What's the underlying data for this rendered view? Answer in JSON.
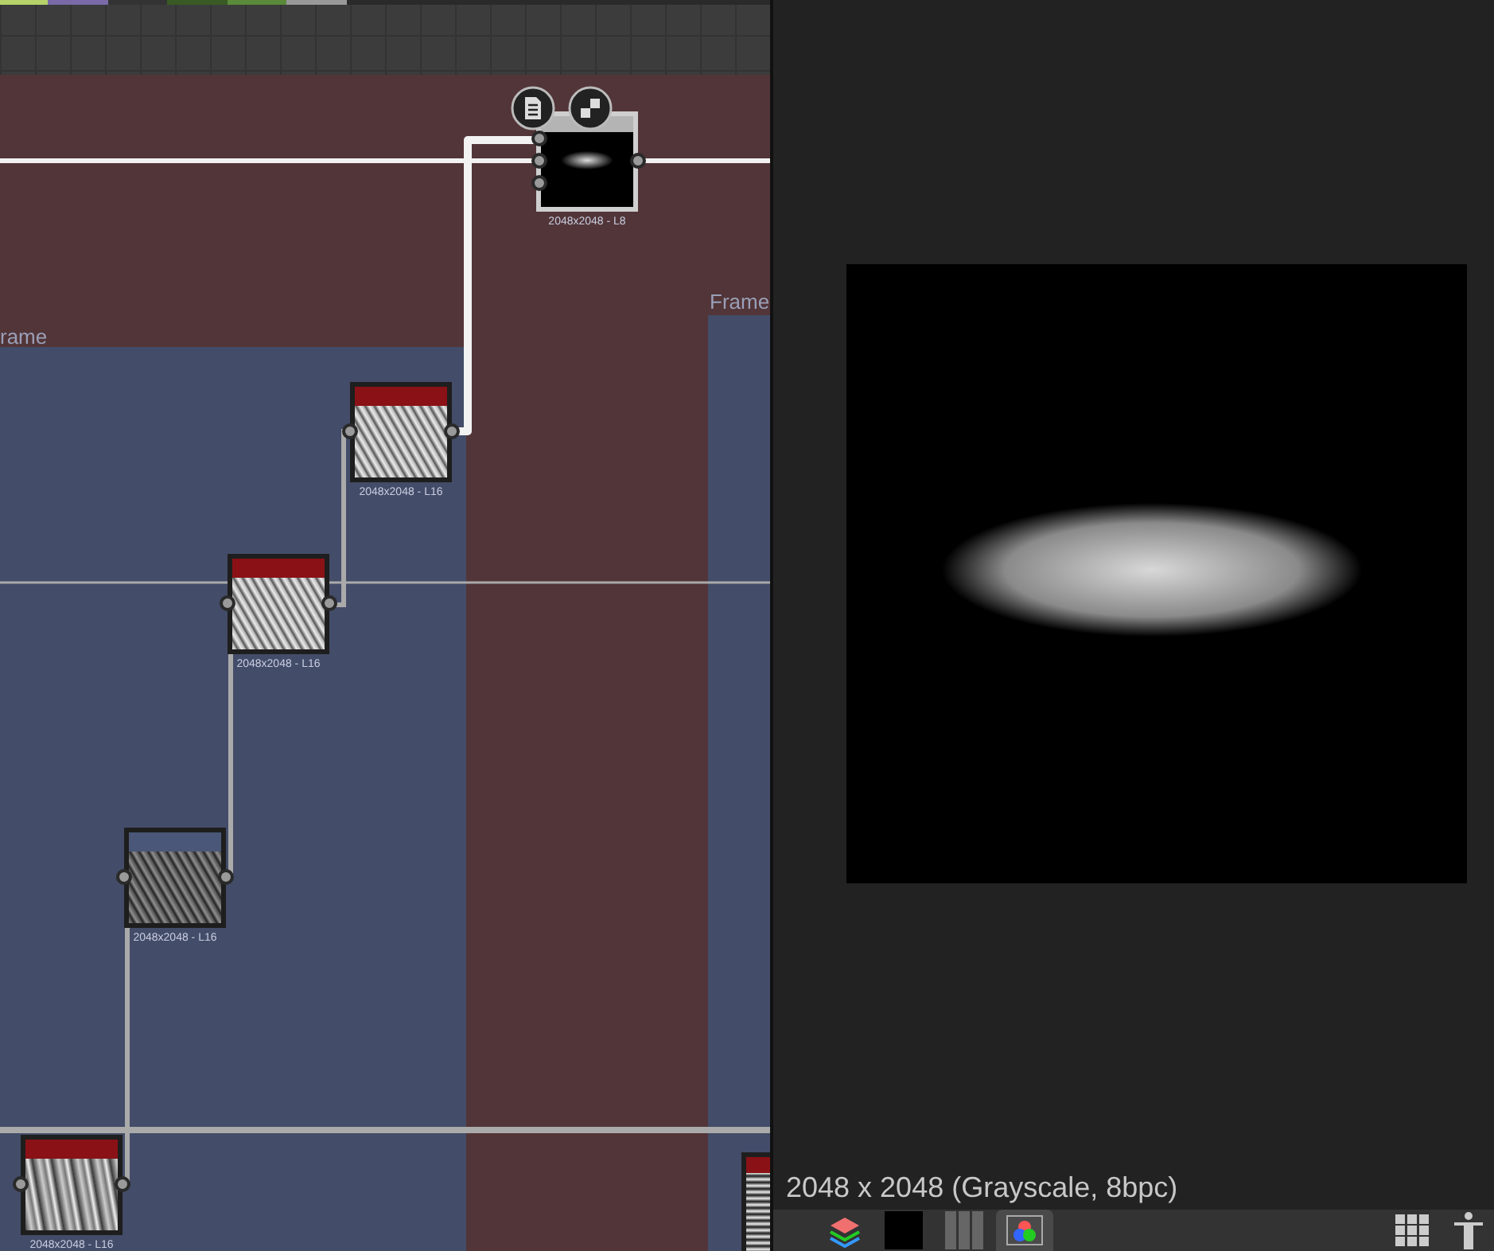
{
  "graph": {
    "frames": [
      {
        "label": "rame"
      },
      {
        "label": "Frame"
      }
    ],
    "nodes": [
      {
        "kind": "blob",
        "color": "#b4b4b4",
        "resolution": "2048x2048 - L8",
        "selected": true
      },
      {
        "kind": "fibers",
        "color": "#8a1116",
        "resolution": "2048x2048 - L16",
        "selected": false
      },
      {
        "kind": "fibers",
        "color": "#8a1116",
        "resolution": "2048x2048 - L16",
        "selected": false
      },
      {
        "kind": "dark",
        "color": "#4a5778",
        "resolution": "2048x2048 - L16",
        "selected": false
      },
      {
        "kind": "streaks",
        "color": "#8a1116",
        "resolution": "2048x2048 - L16",
        "selected": false
      }
    ]
  },
  "preview": {
    "info": "2048 x 2048 (Grayscale, 8bpc)"
  },
  "toolbar": {
    "buttons": [
      {
        "kind": "layers",
        "selected": false
      },
      {
        "kind": "swatch",
        "selected": false
      },
      {
        "kind": "columns",
        "selected": false
      },
      {
        "kind": "channels",
        "selected": true
      },
      {
        "kind": "grid",
        "selected": false
      },
      {
        "kind": "figure",
        "selected": false
      }
    ]
  }
}
